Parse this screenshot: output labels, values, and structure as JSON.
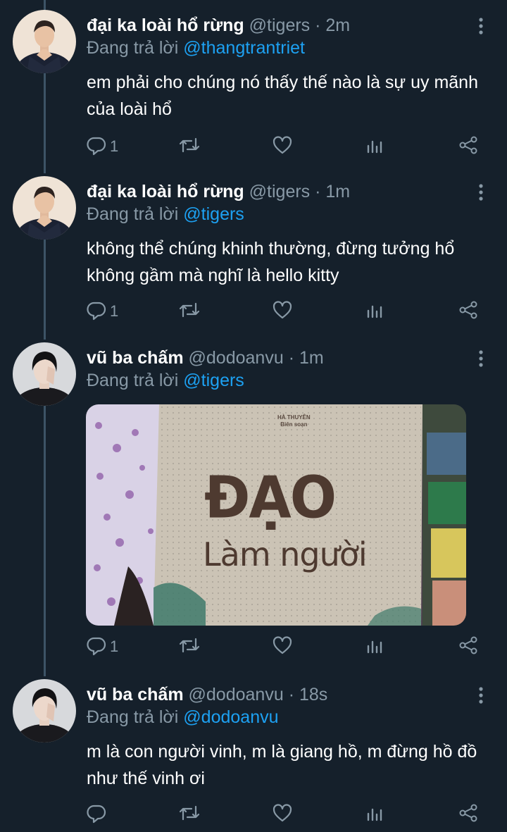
{
  "tweets": [
    {
      "name": "đại ka loài hổ rừng",
      "handle": "@tigers",
      "time": "2m",
      "reply_prefix": "Đang trả lời",
      "reply_to": "@thangtrantriet",
      "text": "em phải cho chúng nó thấy thế nào là sự uy mãnh của loài hổ",
      "reply_count": "1",
      "avatar": "tiger-user-avatar"
    },
    {
      "name": "đại ka loài hổ rừng",
      "handle": "@tigers",
      "time": "1m",
      "reply_prefix": "Đang trả lời",
      "reply_to": "@tigers",
      "text": "không thể chúng khinh thường, đừng tưởng hổ không gầm mà nghĩ là hello kitty",
      "reply_count": "1",
      "avatar": "tiger-user-avatar"
    },
    {
      "name": "vũ ba chấm",
      "handle": "@dodoanvu",
      "time": "1m",
      "reply_prefix": "Đang trả lời",
      "reply_to": "@tigers",
      "reply_count": "1",
      "avatar": "vu-user-avatar",
      "media": {
        "author_line1": "HÀ THUYÊN",
        "author_line2": "Biên soạn",
        "title": "ĐẠO",
        "subtitle": "Làm người"
      }
    },
    {
      "name": "vũ ba chấm",
      "handle": "@dodoanvu",
      "time": "18s",
      "reply_prefix": "Đang trả lời",
      "reply_to": "@dodoanvu",
      "text": "m là con người vinh, m là giang hồ, m đừng hồ đồ như thế vinh ơi",
      "reply_count": "",
      "avatar": "vu-user-avatar"
    }
  ],
  "separator": "·",
  "icons": [
    "reply-icon",
    "retweet-icon",
    "like-icon",
    "analytics-icon",
    "share-icon",
    "more-icon"
  ],
  "colors": {
    "background": "#15202b",
    "secondary_text": "#8899a6",
    "link": "#1da1f2",
    "thread_line": "#3d5466"
  }
}
